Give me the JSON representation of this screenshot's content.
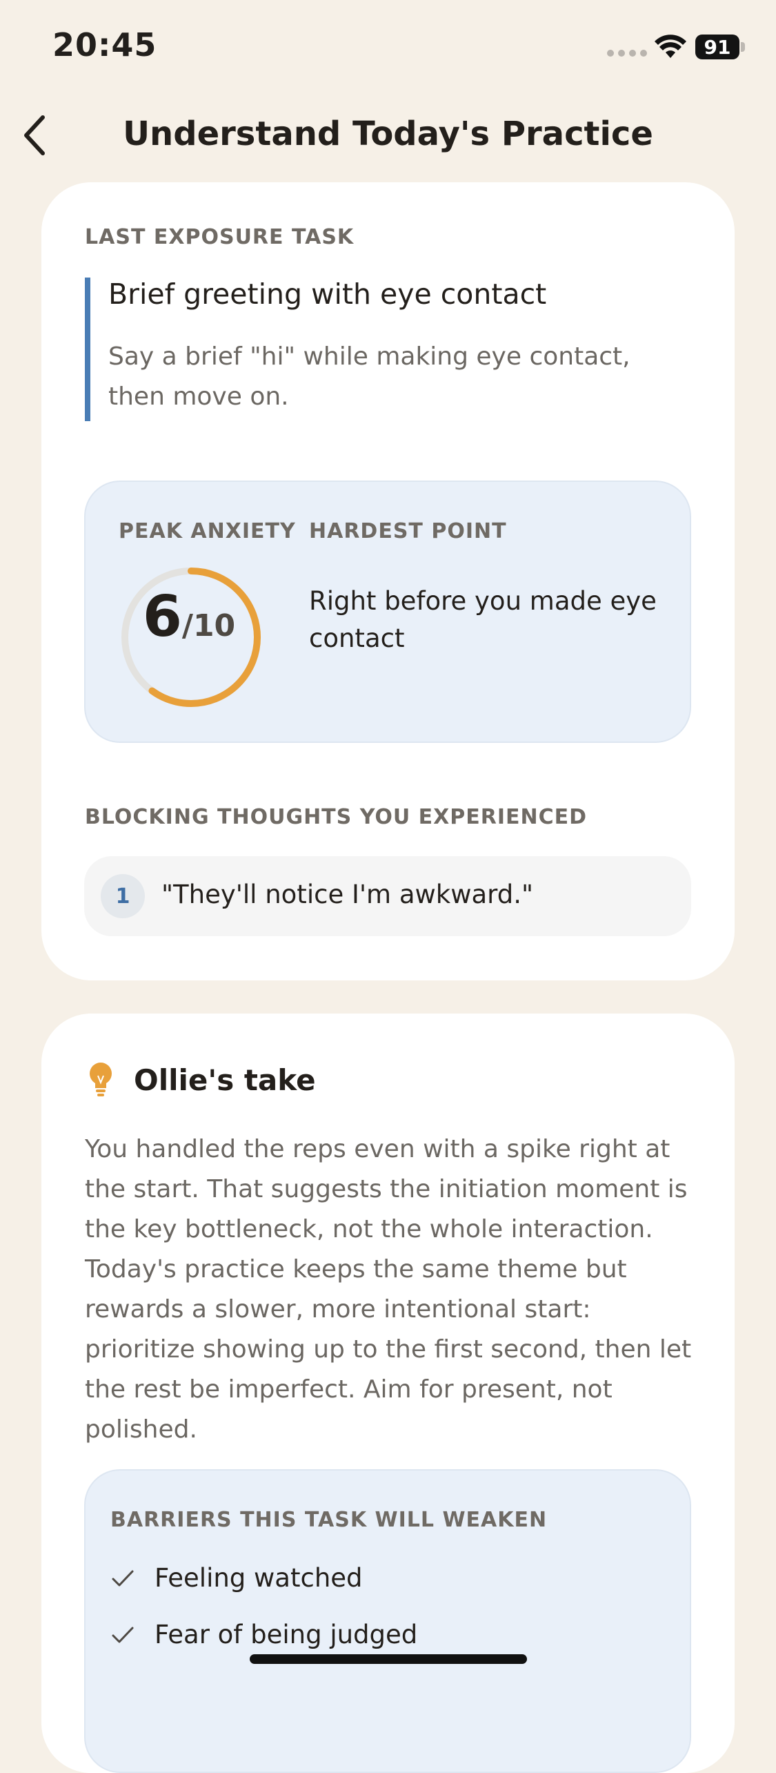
{
  "status_bar": {
    "time": "20:45",
    "battery": "91"
  },
  "header": {
    "title": "Understand Today's Practice"
  },
  "last_task": {
    "section_label": "LAST EXPOSURE TASK",
    "title": "Brief greeting with eye contact",
    "description": "Say a brief \"hi\" while making eye contact, then move on.",
    "accent_color": "#4a7db5"
  },
  "metrics": {
    "peak_label": "PEAK ANXIETY",
    "peak_value": "6",
    "peak_scale": "/10",
    "peak_fraction": 0.6,
    "gauge_color": "#e8a03a",
    "hardest_label": "HARDEST POINT",
    "hardest_text": "Right before you made eye contact"
  },
  "thoughts": {
    "section_label": "BLOCKING THOUGHTS YOU EXPERIENCED",
    "items": [
      {
        "index": "1",
        "text": "\"They'll notice I'm awkward.\""
      }
    ]
  },
  "ollie": {
    "title": "Ollie's take",
    "icon": "lightbulb-icon",
    "body": "You handled the reps even with a spike right at the start. That suggests the initiation moment is the key bottleneck, not the whole interaction. Today's practice keeps the same theme but rewards a slower, more intentional start: prioritize showing up to the first second, then let the rest be imperfect. Aim for present, not polished."
  },
  "barriers": {
    "section_label": "BARRIERS THIS TASK WILL WEAKEN",
    "items": [
      "Feeling watched",
      "Fear of being judged"
    ]
  }
}
